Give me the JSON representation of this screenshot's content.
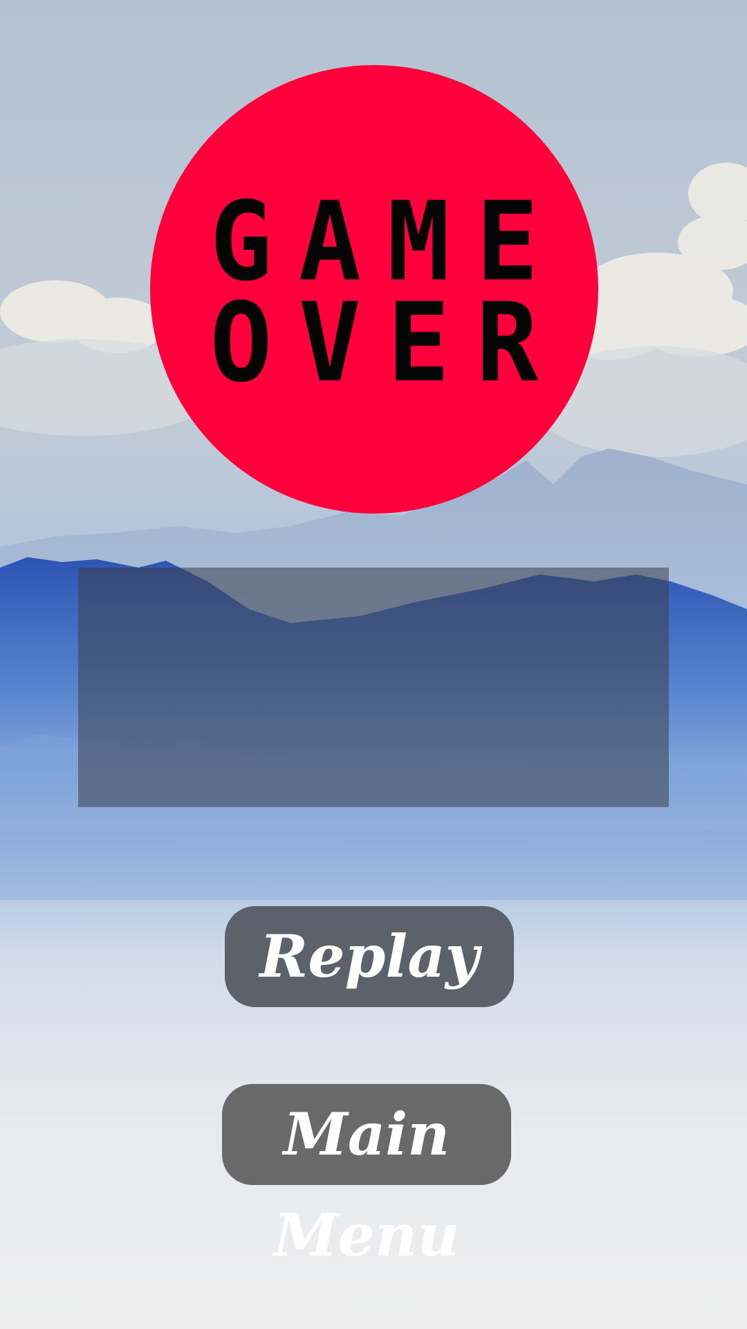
{
  "game_over": {
    "line1": "GAME",
    "line2": "OVER",
    "badge_color": "#ff003c"
  },
  "buttons": {
    "replay_label": "Replay",
    "main_menu_label": "Main Menu"
  },
  "colors": {
    "button_bg": "#54565a",
    "panel_bg": "#3a404a",
    "sky_top": "#b9c7d6",
    "mountain_blue": "#3f66b8"
  }
}
